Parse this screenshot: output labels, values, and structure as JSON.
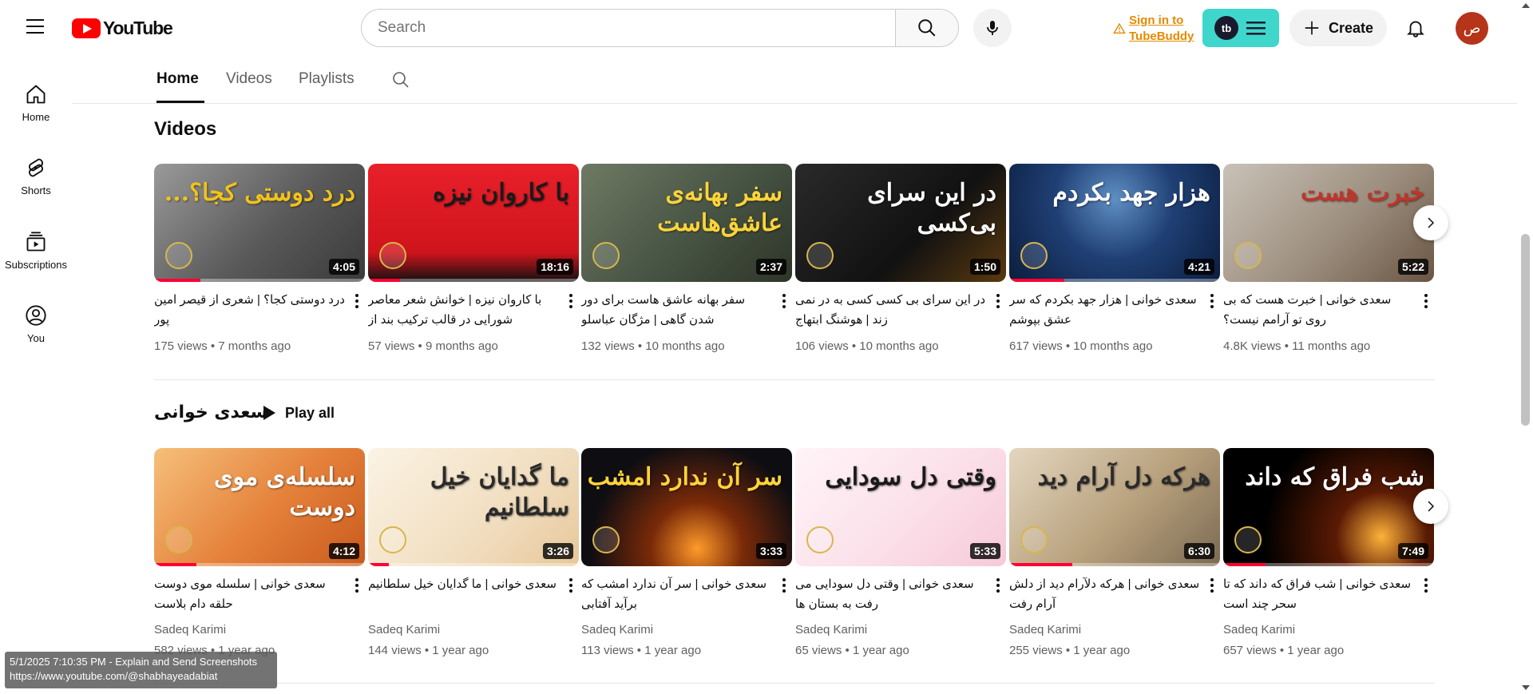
{
  "header": {
    "logo_text": "YouTube",
    "search_placeholder": "Search",
    "signin_label": "Sign in to TubeBuddy",
    "tubebuddy_mark": "tb",
    "create_label": "Create",
    "avatar_letter": "ص"
  },
  "sidebar": {
    "items": [
      {
        "label": "Home",
        "icon": "home-icon"
      },
      {
        "label": "Shorts",
        "icon": "shorts-icon"
      },
      {
        "label": "Subscriptions",
        "icon": "subscriptions-icon"
      },
      {
        "label": "You",
        "icon": "you-icon"
      }
    ]
  },
  "tabs": {
    "items": [
      "Home",
      "Videos",
      "Playlists"
    ],
    "active": "Home"
  },
  "sections": [
    {
      "title": "Videos",
      "videos": [
        {
          "title": "درد دوستی کجا؟ | شعری از قیصر امین پور",
          "views": "175 views",
          "age": "7 months ago",
          "duration": "4:05",
          "progress": 0.22,
          "thumb_text": "درد دوستی کجا؟..."
        },
        {
          "title": "با کاروان نیزه | خوانش شعر معاصر شورایی در قالب ترکیب بند از علیرضا...",
          "views": "57 views",
          "age": "9 months ago",
          "duration": "18:16",
          "progress": 0.15,
          "thumb_text": "با کاروان نیزه"
        },
        {
          "title": "سفر بهانه عاشق هاست برای دور شدن گاهی | مژگان عباسلو",
          "views": "132 views",
          "age": "10 months ago",
          "duration": "2:37",
          "progress": 0.0,
          "thumb_text": "سفر بهانه‌ی عاشق‌هاست"
        },
        {
          "title": "در این سرای بی کسی کسی به در نمی زند | هوشنگ ابتهاج",
          "views": "106 views",
          "age": "10 months ago",
          "duration": "1:50",
          "progress": 0.0,
          "thumb_text": "در این سرای بی‌کسی"
        },
        {
          "title": "سعدی خوانی | هزار جهد بکردم که سر عشق بپوشم",
          "views": "617 views",
          "age": "10 months ago",
          "duration": "4:21",
          "progress": 0.26,
          "thumb_text": "هزار جهد بکردم"
        },
        {
          "title": "سعدی خوانی | خبرت هست که بی روی تو آرامم نیست؟",
          "views": "4.8K views",
          "age": "11 months ago",
          "duration": "5:22",
          "progress": 0.0,
          "thumb_text": "خبرت هست"
        }
      ]
    },
    {
      "title": "سعدی خوانی",
      "playall_label": "Play all",
      "videos": [
        {
          "title": "سعدی خوانی | سلسله موی دوست حلقه دام بلاست",
          "channel": "Sadeq Karimi",
          "views": "582 views",
          "age": "1 year ago",
          "duration": "4:12",
          "progress": 0.2,
          "thumb_text": "سلسله‌ی موی دوست"
        },
        {
          "title": "سعدی خوانی | ما گدایان خیل سلطانیم",
          "channel": "Sadeq Karimi",
          "views": "144 views",
          "age": "1 year ago",
          "duration": "3:26",
          "progress": 0.1,
          "thumb_text": "ما گدایان خیل سلطانیم"
        },
        {
          "title": "سعدی خوانی | سر آن ندارد امشب که برآید آفتابی",
          "channel": "Sadeq Karimi",
          "views": "113 views",
          "age": "1 year ago",
          "duration": "3:33",
          "progress": 0.0,
          "thumb_text": "سر آن ندارد امشب"
        },
        {
          "title": "سعدی خوانی | وقتی دل سودایی می رفت به بستان ها",
          "channel": "Sadeq Karimi",
          "views": "65 views",
          "age": "1 year ago",
          "duration": "5:33",
          "progress": 0.0,
          "thumb_text": "وقتی دل سودایی"
        },
        {
          "title": "سعدی خوانی | هرکه دلآرام دید از دلش آرام رفت",
          "channel": "Sadeq Karimi",
          "views": "255 views",
          "age": "1 year ago",
          "duration": "6:30",
          "progress": 0.3,
          "thumb_text": "هرکه دل آرام دید"
        },
        {
          "title": "سعدی خوانی | شب فراق که داند که تا سحر چند است",
          "channel": "Sadeq Karimi",
          "views": "657 views",
          "age": "1 year ago",
          "duration": "7:49",
          "progress": 0.2,
          "thumb_text": "شب فراق که داند"
        }
      ]
    }
  ],
  "status_box": {
    "line1": "5/1/2025 7:10:35 PM - Explain and Send Screenshots",
    "line2": "https://www.youtube.com/@shabhayeadabiat"
  },
  "colors": {
    "brand_red": "#ff0000",
    "progress_red": "#ff0033",
    "tubebuddy": "#3fd6cc",
    "signin_orange": "#e58a00",
    "avatar_bg": "#b5341a"
  }
}
